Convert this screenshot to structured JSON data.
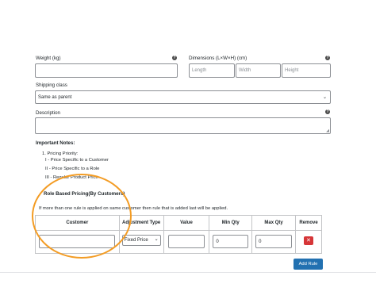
{
  "fields": {
    "weight_label": "Weight (kg)",
    "dimensions_label": "Dimensions (L×W×H) (cm)",
    "length_placeholder": "Length",
    "width_placeholder": "Width",
    "height_placeholder": "Height",
    "shipping_class_label": "Shipping class",
    "shipping_class_value": "Same as parent",
    "description_label": "Description"
  },
  "notes": {
    "heading": "Important Notes:",
    "priority_title": "1. Pricing Priority:",
    "priority_items": [
      "I - Price Specific to a Customer",
      "II - Price Specific to a Role",
      "III - Regular Product Price"
    ]
  },
  "role_pricing": {
    "title": "Role Based Pricing(By Customers)",
    "info": "If more than one rule is applied on same customer then rule that is added last will be applied.",
    "columns": [
      "Customer",
      "Adjustment Type",
      "Value",
      "Min Qty",
      "Max Qty",
      "Remove"
    ],
    "row": {
      "customer": "",
      "adjustment_type": "Fixed Price",
      "value": "",
      "min_qty": "0",
      "max_qty": "0"
    },
    "add_rule_label": "Add Rule",
    "remove_glyph": "✕"
  },
  "colors": {
    "primary_button": "#2271b1",
    "remove_button": "#d63638",
    "annotation_circle": "#f39c24"
  }
}
